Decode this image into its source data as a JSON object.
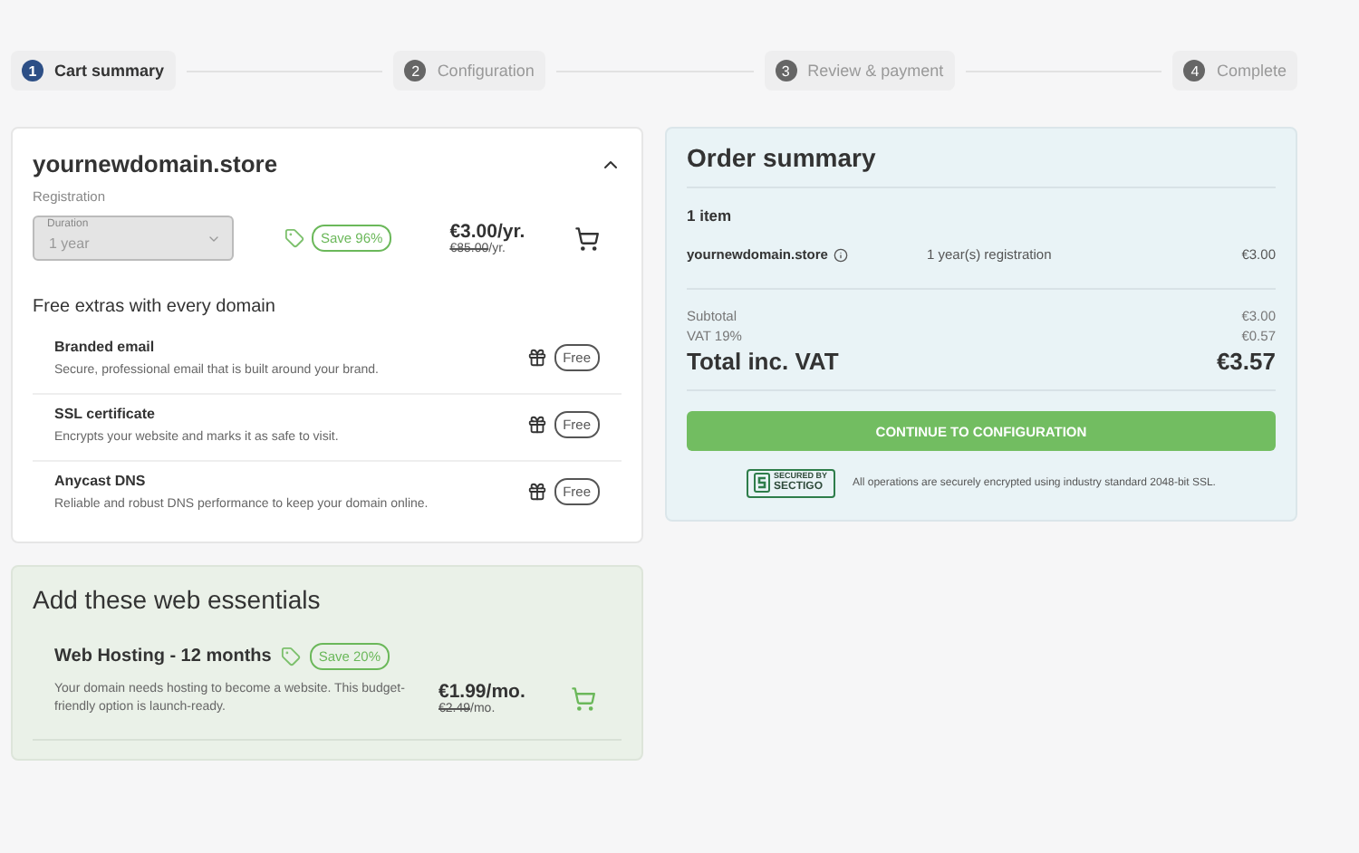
{
  "steps": [
    {
      "number": "1",
      "label": "Cart summary",
      "selected": true
    },
    {
      "number": "2",
      "label": "Configuration",
      "selected": false
    },
    {
      "number": "3",
      "label": "Review & payment",
      "selected": false
    },
    {
      "number": "4",
      "label": "Complete",
      "selected": false
    }
  ],
  "domain": {
    "name": "yournewdomain.store",
    "expanded": true,
    "registration_label": "Registration",
    "duration": {
      "label": "Duration",
      "value": "1 year",
      "disabled": true
    },
    "badge": "Save 96%",
    "price": "€3.00/yr.",
    "old_price": "€85.00",
    "old_unit": "/yr."
  },
  "extras": {
    "title": "Free extras with every domain",
    "items": [
      {
        "name": "Branded email",
        "description": "Secure, professional email that is built around your brand.",
        "badge": "Free"
      },
      {
        "name": "SSL certificate",
        "description": "Encrypts your website and marks it as safe to visit.",
        "badge": "Free"
      },
      {
        "name": "Anycast DNS",
        "description": "Reliable and robust DNS performance to keep your domain online.",
        "badge": "Free"
      }
    ]
  },
  "essentials": {
    "title": "Add these web essentials",
    "items": [
      {
        "name": "Web Hosting - 12 months",
        "badge": "Save 20%",
        "description": "Your domain needs hosting to become a website. This budget-friendly option is launch-ready.",
        "price": "€1.99/mo.",
        "old_price": "€2.49",
        "old_unit": "/mo."
      }
    ]
  },
  "order_summary": {
    "title": "Order summary",
    "count": "1 item",
    "line": {
      "name": "yournewdomain.store",
      "term": "1 year(s) registration",
      "price": "€3.00"
    },
    "subtotal_label": "Subtotal",
    "subtotal": "€3.00",
    "vat_label": "VAT 19%",
    "vat": "€0.57",
    "total_label": "Total inc. VAT",
    "total": "€3.57",
    "button": "CONTINUE TO CONFIGURATION",
    "seal_top": "SECURED BY",
    "seal_bottom": "SECTIGO",
    "security_note": "All operations are securely encrypted using industry standard 2048-bit SSL."
  }
}
